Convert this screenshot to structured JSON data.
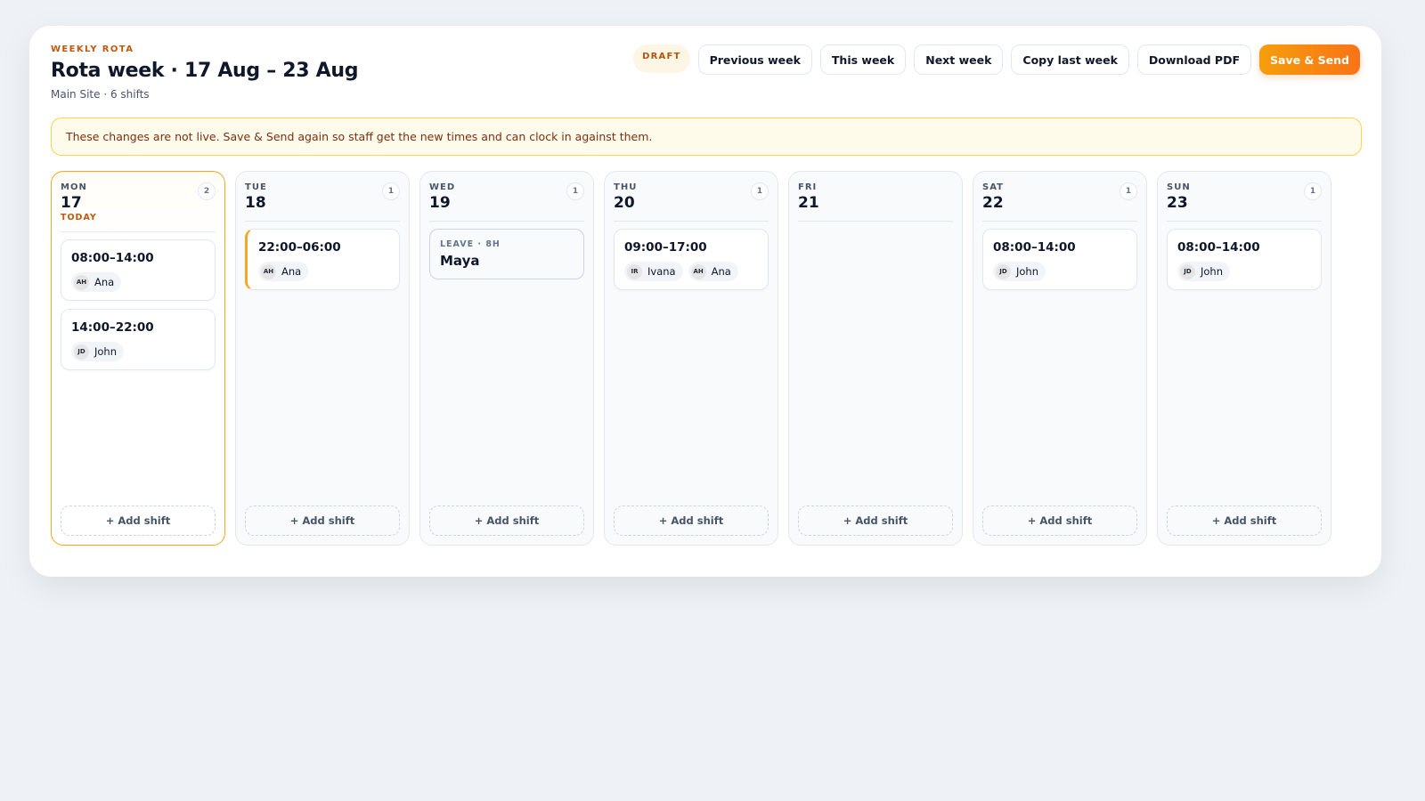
{
  "header": {
    "eyebrow": "WEEKLY ROTA",
    "title": "Rota week · 17 Aug – 23 Aug",
    "subtitle": "Main Site · 6 shifts",
    "status_badge": "DRAFT",
    "buttons": {
      "previous_week": "Previous week",
      "this_week": "This week",
      "next_week": "Next week",
      "copy_last_week": "Copy last week",
      "download_pdf": "Download PDF",
      "save_send": "Save & Send"
    }
  },
  "notice": "These changes are not live. Save & Send again so staff get the new times and can clock in against them.",
  "colors": {
    "accent": "#f97316",
    "today_border": "#f5a623",
    "notice_bg": "#fffbea"
  },
  "days": [
    {
      "dow": "MON",
      "date": "17",
      "today_label": "TODAY",
      "count": "2",
      "add_label": "+ Add shift",
      "shifts": [
        {
          "time": "08:00–14:00",
          "people": [
            {
              "initials": "AH",
              "name": "Ana"
            }
          ]
        },
        {
          "time": "14:00–22:00",
          "people": [
            {
              "initials": "JD",
              "name": "John"
            }
          ]
        }
      ]
    },
    {
      "dow": "TUE",
      "date": "18",
      "count": "1",
      "add_label": "+ Add shift",
      "shifts": [
        {
          "time": "22:00–06:00",
          "overnight": true,
          "people": [
            {
              "initials": "AH",
              "name": "Ana"
            }
          ]
        }
      ]
    },
    {
      "dow": "WED",
      "date": "19",
      "count": "1",
      "add_label": "+ Add shift",
      "leave": {
        "label": "LEAVE · 8H",
        "name": "Maya"
      }
    },
    {
      "dow": "THU",
      "date": "20",
      "count": "1",
      "add_label": "+ Add shift",
      "shifts": [
        {
          "time": "09:00–17:00",
          "people": [
            {
              "initials": "IR",
              "name": "Ivana"
            },
            {
              "initials": "AH",
              "name": "Ana"
            }
          ]
        }
      ]
    },
    {
      "dow": "FRI",
      "date": "21",
      "add_label": "+ Add shift"
    },
    {
      "dow": "SAT",
      "date": "22",
      "count": "1",
      "add_label": "+ Add shift",
      "shifts": [
        {
          "time": "08:00–14:00",
          "people": [
            {
              "initials": "JD",
              "name": "John"
            }
          ]
        }
      ]
    },
    {
      "dow": "SUN",
      "date": "23",
      "count": "1",
      "add_label": "+ Add shift",
      "shifts": [
        {
          "time": "08:00–14:00",
          "people": [
            {
              "initials": "JD",
              "name": "John"
            }
          ]
        }
      ]
    }
  ]
}
